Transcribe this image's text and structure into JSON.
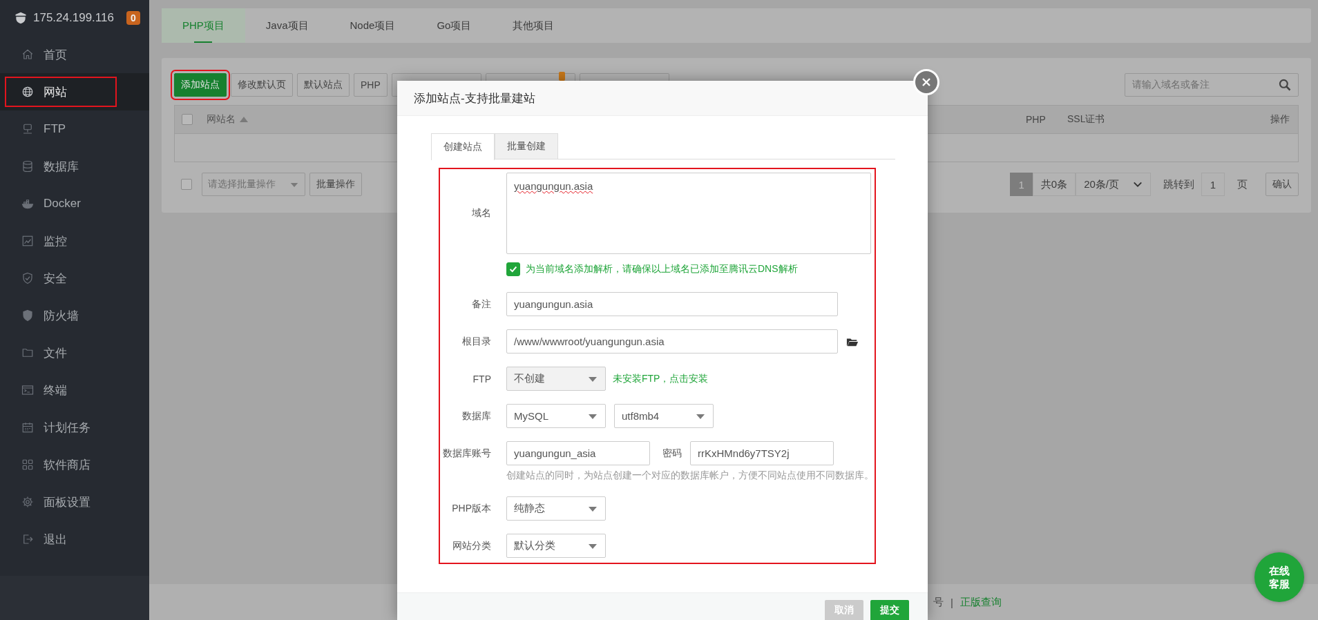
{
  "server": {
    "ip": "175.24.199.116",
    "badge": "0"
  },
  "sidebar": {
    "items": [
      {
        "label": "首页",
        "selected": false,
        "annotated": false
      },
      {
        "label": "网站",
        "selected": true,
        "annotated": true
      },
      {
        "label": "FTP",
        "selected": false,
        "annotated": false
      },
      {
        "label": "数据库",
        "selected": false,
        "annotated": false
      },
      {
        "label": "Docker",
        "selected": false,
        "annotated": false
      },
      {
        "label": "监控",
        "selected": false,
        "annotated": false
      },
      {
        "label": "安全",
        "selected": false,
        "annotated": false
      },
      {
        "label": "防火墙",
        "selected": false,
        "annotated": false
      },
      {
        "label": "文件",
        "selected": false,
        "annotated": false
      },
      {
        "label": "终端",
        "selected": false,
        "annotated": false
      },
      {
        "label": "计划任务",
        "selected": false,
        "annotated": false
      },
      {
        "label": "软件商店",
        "selected": false,
        "annotated": false
      },
      {
        "label": "面板设置",
        "selected": false,
        "annotated": false
      },
      {
        "label": "退出",
        "selected": false,
        "annotated": false
      }
    ]
  },
  "project_tabs": [
    {
      "label": "PHP项目",
      "selected": true
    },
    {
      "label": "Java项目",
      "selected": false
    },
    {
      "label": "Node项目",
      "selected": false
    },
    {
      "label": "Go项目",
      "selected": false
    },
    {
      "label": "其他项目",
      "selected": false
    }
  ],
  "toolbar": {
    "buttons": [
      {
        "kind": "primary",
        "label": "添加站点",
        "annotated": true
      },
      {
        "kind": "default",
        "label": "修改默认页",
        "annotated": false
      },
      {
        "kind": "default",
        "label": "默认站点",
        "annotated": false
      },
      {
        "kind": "default",
        "label": "PHP",
        "annotated": false
      },
      {
        "kind": "blank",
        "badge": false
      },
      {
        "kind": "blank",
        "badge": true
      },
      {
        "kind": "blank",
        "badge": false
      }
    ],
    "search": {
      "placeholder": "请输入域名或备注"
    }
  },
  "table": {
    "select_all": {
      "checked": false
    },
    "columns": [
      {
        "label": "网站名"
      },
      {
        "label": "PHP"
      },
      {
        "label": "SSL证书"
      },
      {
        "label": "操作"
      }
    ]
  },
  "batch": {
    "checked": false,
    "placeholder": "请选择批量操作",
    "button": "批量操作"
  },
  "pagination": {
    "pages": [
      {
        "label": "1",
        "selected": true
      }
    ],
    "total": "共0条",
    "page_size": "20条/页",
    "goto_label": "跳转到",
    "goto_value": "1",
    "page_unit": "页",
    "confirm": "确认"
  },
  "footer": {
    "text": "号",
    "separator": "|",
    "link": "正版查询"
  },
  "chat_button": {
    "label": "在线客服"
  },
  "dialog": {
    "title": "添加站点-支持批量建站",
    "tabs": [
      {
        "label": "创建站点",
        "selected": true
      },
      {
        "label": "批量创建",
        "selected": false
      }
    ],
    "annotated": true,
    "form": [
      {
        "kind": "textarea",
        "label": "域名",
        "value": "yuangungun.asia",
        "spellcheck_error": true
      },
      {
        "kind": "checkbox",
        "checked": true,
        "text": "为当前域名添加解析，请确保以上域名已添加至腾讯云DNS解析"
      },
      {
        "kind": "input",
        "label": "备注",
        "value": "yuangungun.asia",
        "browse": false
      },
      {
        "kind": "input",
        "label": "根目录",
        "value": "/www/wwwroot/yuangungun.asia",
        "browse": true
      },
      {
        "kind": "select",
        "label": "FTP",
        "value": "不创建",
        "disabled": true,
        "note": "未安装FTP，点击安装"
      },
      {
        "kind": "select",
        "label": "数据库",
        "value": "MySQL",
        "disabled": false,
        "extra_select": "utf8mb4"
      },
      {
        "kind": "credentials",
        "label": "数据库账号",
        "value": "yuangungun_asia",
        "password_label": "密码",
        "password": "rrKxHMnd6y7TSY2j"
      },
      {
        "kind": "hint",
        "text": "创建站点的同时，为站点创建一个对应的数据库帐户，方便不同站点使用不同数据库。"
      },
      {
        "kind": "select",
        "label": "PHP版本",
        "value": "纯静态",
        "disabled": false
      },
      {
        "kind": "select",
        "label": "网站分类",
        "value": "默认分类",
        "disabled": false
      }
    ],
    "buttons": [
      {
        "kind": "cancel",
        "label": "取消"
      },
      {
        "kind": "primary",
        "label": "提交"
      }
    ]
  }
}
